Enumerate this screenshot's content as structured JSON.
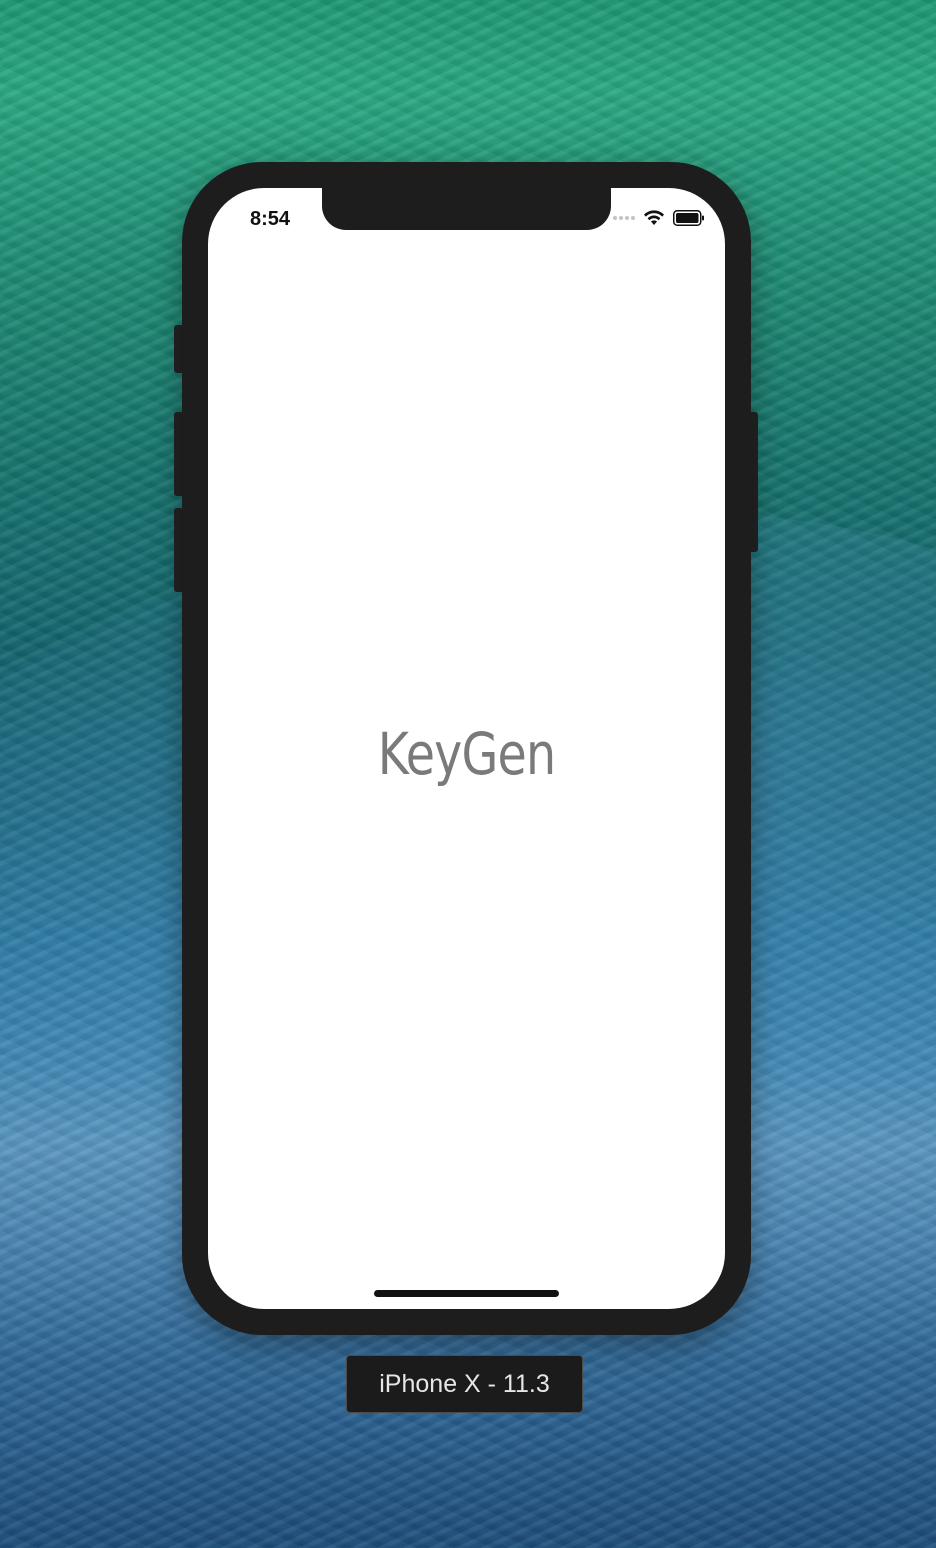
{
  "simulator": {
    "device_label": "iPhone X - 11.3"
  },
  "status_bar": {
    "time": "8:54",
    "icons": [
      "signal-icon",
      "wifi-icon",
      "battery-icon"
    ]
  },
  "app": {
    "title": "KeyGen",
    "title_color": "#7a7a7a",
    "background_color": "#ffffff"
  }
}
